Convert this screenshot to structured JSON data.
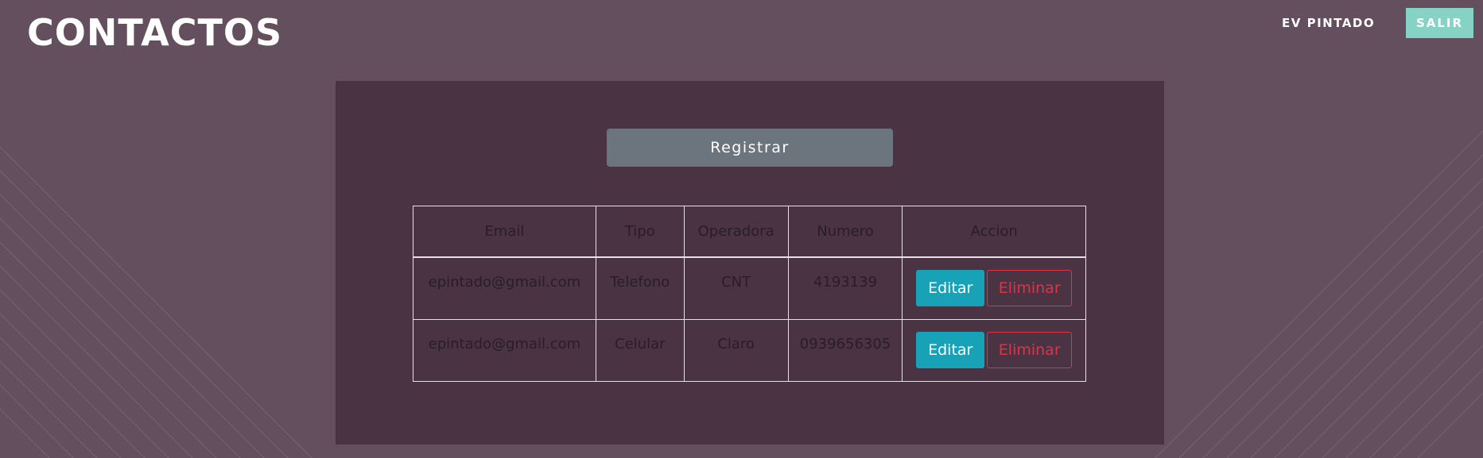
{
  "header": {
    "title": "CONTACTOS",
    "user_name": "EV PINTADO",
    "logout_label": "SALIR"
  },
  "main": {
    "register_label": "Registrar",
    "table": {
      "headers": [
        "Email",
        "Tipo",
        "Operadora",
        "Numero",
        "Accion"
      ],
      "rows": [
        {
          "email": "epintado@gmail.com",
          "tipo": "Telefono",
          "operadora": "CNT",
          "numero": "4193139",
          "edit_label": "Editar",
          "delete_label": "Eliminar"
        },
        {
          "email": "epintado@gmail.com",
          "tipo": "Celular",
          "operadora": "Claro",
          "numero": "0939656305",
          "edit_label": "Editar",
          "delete_label": "Eliminar"
        }
      ]
    }
  },
  "colors": {
    "background": "#634f5e",
    "panel": "#4a3343",
    "logout_button": "#86d3c6",
    "register_button": "#6c757d",
    "edit_button": "#17a2b8",
    "delete_outline": "#dc3545"
  }
}
